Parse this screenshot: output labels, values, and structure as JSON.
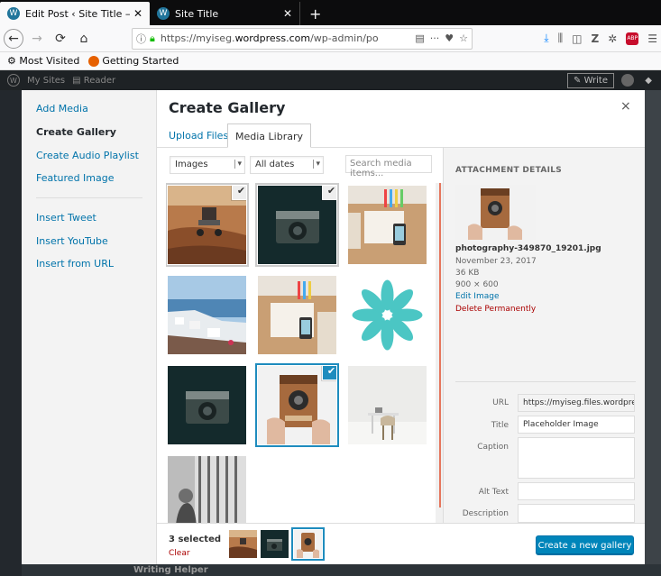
{
  "browser": {
    "tabs": [
      {
        "title": "Edit Post ‹ Site Title — W",
        "active": true
      },
      {
        "title": "Site Title",
        "active": false
      }
    ],
    "url_prefix": "https://myiseg.",
    "url_domain": "wordpress.com",
    "url_suffix": "/wp-admin/po",
    "bookmarks": [
      "Most Visited",
      "Getting Started"
    ]
  },
  "wp_admin_bar": {
    "my_sites": "My Sites",
    "reader": "Reader",
    "write": "Write"
  },
  "background": {
    "writing_helper": "Writing Helper"
  },
  "media_menu": {
    "items": [
      "Add Media",
      "Create Gallery",
      "Create Audio Playlist",
      "Featured Image"
    ],
    "items2": [
      "Insert Tweet",
      "Insert YouTube",
      "Insert from URL"
    ],
    "active": "Create Gallery"
  },
  "frame": {
    "title": "Create Gallery",
    "close": "×",
    "tabs": [
      "Upload Files",
      "Media Library"
    ],
    "active_tab": "Media Library"
  },
  "filters": {
    "type": "Images",
    "date": "All dates",
    "search_placeholder": "Search media items..."
  },
  "grid": {
    "items": [
      {
        "name": "mars-rover",
        "selected": true,
        "current": false
      },
      {
        "name": "camera-dark",
        "selected": true,
        "current": false
      },
      {
        "name": "desk-flatlay-1",
        "selected": false,
        "current": false
      },
      {
        "name": "santorini",
        "selected": false,
        "current": false
      },
      {
        "name": "desk-flatlay-2",
        "selected": false,
        "current": false
      },
      {
        "name": "teal-flower",
        "selected": false,
        "current": false
      },
      {
        "name": "camera-dark-2",
        "selected": false,
        "current": false
      },
      {
        "name": "box-camera",
        "selected": true,
        "current": true
      },
      {
        "name": "white-desk-chair",
        "selected": false,
        "current": false
      },
      {
        "name": "child-window",
        "selected": false,
        "current": false
      }
    ]
  },
  "attachment": {
    "heading": "ATTACHMENT DETAILS",
    "filename": "photography-349870_19201.jpg",
    "date": "November 23, 2017",
    "size": "36 KB",
    "dimensions": "900 × 600",
    "edit": "Edit Image",
    "delete": "Delete Permanently",
    "fields": {
      "url_label": "URL",
      "url_value": "https://myiseg.files.wordpre",
      "title_label": "Title",
      "title_value": "Placeholder Image",
      "caption_label": "Caption",
      "alt_label": "Alt Text",
      "desc_label": "Description"
    }
  },
  "toolbar": {
    "selected": "3 selected",
    "clear": "Clear",
    "button": "Create a new gallery"
  },
  "colors": {
    "primary": "#0085ba",
    "link": "#0073aa",
    "danger": "#a00000",
    "selection": "#1e8cbe"
  }
}
